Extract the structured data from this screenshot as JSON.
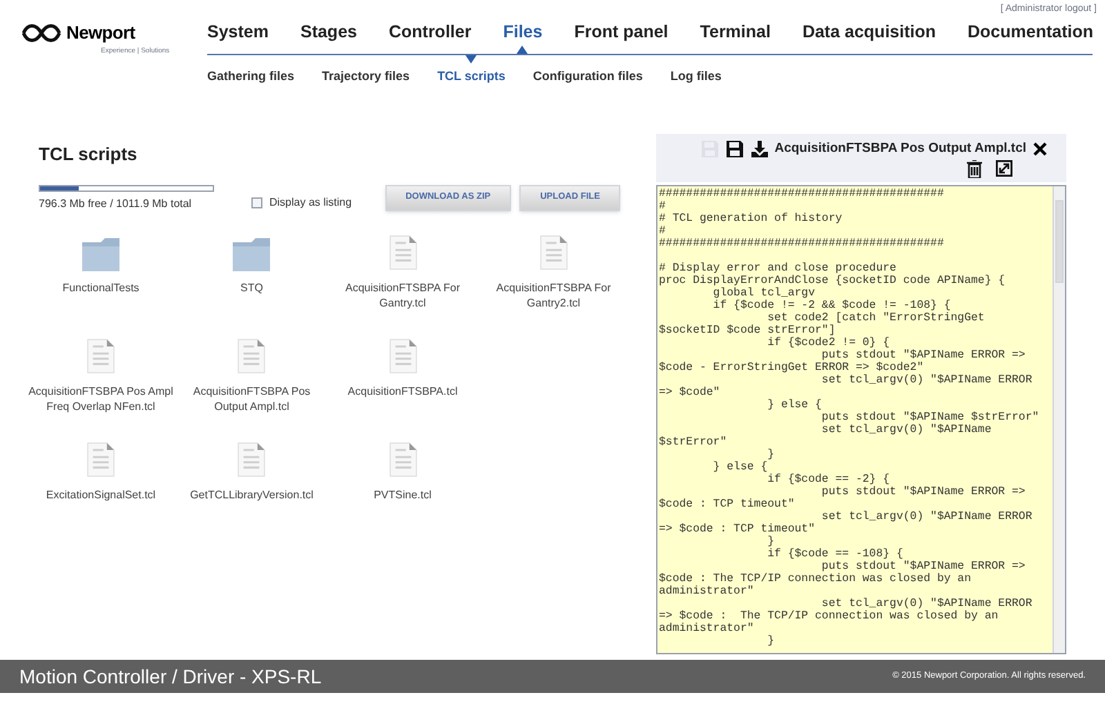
{
  "header": {
    "logo": {
      "name": "Newport",
      "tagline": "Experience | Solutions"
    },
    "user_link": "[ Administrator logout ]",
    "tabs": [
      {
        "label": "System",
        "selected": false
      },
      {
        "label": "Stages",
        "selected": false
      },
      {
        "label": "Controller",
        "selected": false
      },
      {
        "label": "Files",
        "selected": true
      },
      {
        "label": "Front panel",
        "selected": false
      },
      {
        "label": "Terminal",
        "selected": false
      },
      {
        "label": "Data acquisition",
        "selected": false
      },
      {
        "label": "Documentation",
        "selected": false
      }
    ],
    "subtabs": [
      {
        "label": "Gathering files",
        "selected": false
      },
      {
        "label": "Trajectory files",
        "selected": false
      },
      {
        "label": "TCL scripts",
        "selected": true
      },
      {
        "label": "Configuration files",
        "selected": false
      },
      {
        "label": "Log files",
        "selected": false
      }
    ]
  },
  "files_panel": {
    "title": "TCL scripts",
    "storage": {
      "level": 0.22,
      "text": "796.3 Mb free / 1011.9 Mb total"
    },
    "display_as_listing": {
      "label": "Display as listing",
      "checked": false
    },
    "buttons": [
      "DOWNLOAD AS ZIP",
      "UPLOAD FILE"
    ],
    "items": [
      {
        "kind": "folder",
        "label": "FunctionalTests"
      },
      {
        "kind": "folder",
        "label": "STQ"
      },
      {
        "kind": "file",
        "label": "AcquisitionFTSBPA For Gantry.tcl"
      },
      {
        "kind": "file",
        "label": "AcquisitionFTSBPA For Gantry2.tcl"
      },
      {
        "kind": "file",
        "label": "AcquisitionFTSBPA Pos Ampl Freq Overlap NFen.tcl"
      },
      {
        "kind": "file",
        "label": "AcquisitionFTSBPA Pos Output Ampl.tcl"
      },
      {
        "kind": "file",
        "label": "AcquisitionFTSBPA.tcl"
      },
      {
        "kind": "break"
      },
      {
        "kind": "file",
        "label": "ExcitationSignalSet.tcl"
      },
      {
        "kind": "file",
        "label": "GetTCLLibraryVersion.tcl"
      },
      {
        "kind": "file",
        "label": "PVTSine.tcl"
      }
    ]
  },
  "editor": {
    "toolbar": [
      {
        "kind": "save",
        "disabled": true
      },
      {
        "kind": "save",
        "disabled": false
      },
      {
        "kind": "download",
        "disabled": false
      }
    ],
    "filename": "AcquisitionFTSBPA Pos Output Ampl.tcl",
    "code": "##########################################\n#\n# TCL generation of history\n#\n##########################################\n\n# Display error and close procedure\nproc DisplayErrorAndClose {socketID code APIName} {\n        global tcl_argv\n        if {$code != -2 && $code != -108} {\n                set code2 [catch \"ErrorStringGet\n$socketID $code strError\"]\n                if {$code2 != 0} {\n                        puts stdout \"$APIName ERROR =>\n$code - ErrorStringGet ERROR => $code2\"\n                        set tcl_argv(0) \"$APIName ERROR\n=> $code\"\n                } else {\n                        puts stdout \"$APIName $strError\"\n                        set tcl_argv(0) \"$APIName\n$strError\"\n                }\n        } else {\n                if {$code == -2} {\n                        puts stdout \"$APIName ERROR =>\n$code : TCP timeout\"\n                        set tcl_argv(0) \"$APIName ERROR\n=> $code : TCP timeout\"\n                }\n                if {$code == -108} {\n                        puts stdout \"$APIName ERROR =>\n$code : The TCP/IP connection was closed by an\nadministrator\"\n                        set tcl_argv(0) \"$APIName ERROR\n=> $code :  The TCP/IP connection was closed by an\nadministrator\"\n                }"
  },
  "footer": {
    "title": "Motion Controller / Driver - XPS-RL",
    "copyright": "© 2015 Newport Corporation. All rights reserved."
  }
}
